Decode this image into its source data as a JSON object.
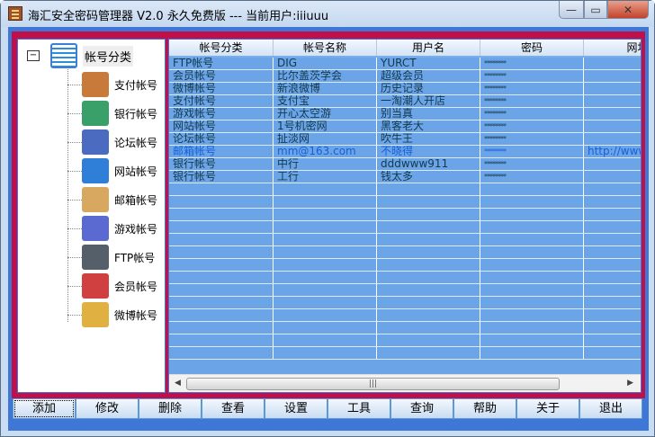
{
  "window": {
    "title": "海汇安全密码管理器 V2.0 永久免费版 --- 当前用户:iiiuuu",
    "min": "—",
    "max": "▭",
    "close": "✕"
  },
  "tree": {
    "root": {
      "toggle": "−",
      "label": "帐号分类"
    },
    "items": [
      {
        "label": "支付帐号",
        "icon": "calculator-icon",
        "color": "#c77a3a"
      },
      {
        "label": "银行帐号",
        "icon": "bank-cards-icon",
        "color": "#3aa06a"
      },
      {
        "label": "论坛帐号",
        "icon": "forum-window-icon",
        "color": "#4a6bbf"
      },
      {
        "label": "网站帐号",
        "icon": "network-icon",
        "color": "#2f7fd8"
      },
      {
        "label": "邮箱帐号",
        "icon": "envelope-icon",
        "color": "#d8a860"
      },
      {
        "label": "游戏帐号",
        "icon": "gamepad-icon",
        "color": "#5a6ad0"
      },
      {
        "label": "FTP帐号",
        "icon": "computer-icon",
        "color": "#555f6a"
      },
      {
        "label": "会员帐号",
        "icon": "users-icon",
        "color": "#d04040"
      },
      {
        "label": "微博帐号",
        "icon": "document-icon",
        "color": "#e0b040"
      }
    ]
  },
  "grid": {
    "columns": [
      "帐号分类",
      "帐号名称",
      "用户名",
      "密码",
      "网址"
    ],
    "rows": [
      [
        "FTP帐号",
        "DIG",
        "YURCT",
        "********",
        ""
      ],
      [
        "会员帐号",
        "比尔盖茨学会",
        "超级会员",
        "********",
        ""
      ],
      [
        "微博帐号",
        "新浪微博",
        "历史记录",
        "********",
        ""
      ],
      [
        "支付帐号",
        "支付宝",
        "一淘潮人开店",
        "********",
        ""
      ],
      [
        "游戏帐号",
        "开心太空游",
        "别当真",
        "********",
        ""
      ],
      [
        "网站帐号",
        "1号机密网",
        "黑客老大",
        "********",
        ""
      ],
      [
        "论坛帐号",
        "扯淡网",
        "吹牛王",
        "********",
        ""
      ],
      [
        "邮箱帐号",
        "mm@163.com",
        "不晓得",
        "********",
        "http://www"
      ],
      [
        "银行帐号",
        "中行",
        "dddwww911",
        "********",
        ""
      ],
      [
        "银行帐号",
        "工行",
        "钱太多",
        "********",
        ""
      ]
    ],
    "selected_row": 7
  },
  "buttons": [
    "添加",
    "修改",
    "删除",
    "查看",
    "设置",
    "工具",
    "查询",
    "帮助",
    "关于",
    "退出"
  ]
}
